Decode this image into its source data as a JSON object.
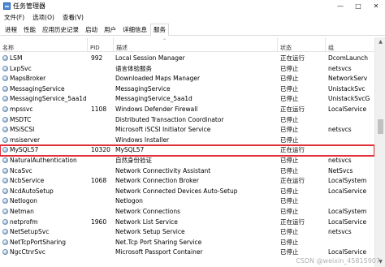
{
  "window": {
    "title": "任务管理器",
    "controls": [
      "—",
      "□",
      "✕"
    ]
  },
  "menu": [
    "文件(F)",
    "选项(O)",
    "查看(V)"
  ],
  "tabs": [
    "进程",
    "性能",
    "应用历史记录",
    "启动",
    "用户",
    "详细信息",
    "服务"
  ],
  "active_tab": "服务",
  "columns": {
    "name": "名称",
    "pid": "PID",
    "desc": "描述",
    "status": "状态",
    "group": "组"
  },
  "rows": [
    {
      "name": "LSM",
      "pid": "992",
      "desc": "Local Session Manager",
      "status": "正在运行",
      "group": "DcomLaunch"
    },
    {
      "name": "LxpSvc",
      "pid": "",
      "desc": "语言体验服务",
      "status": "已停止",
      "group": "netsvcs"
    },
    {
      "name": "MapsBroker",
      "pid": "",
      "desc": "Downloaded Maps Manager",
      "status": "已停止",
      "group": "NetworkServ"
    },
    {
      "name": "MessagingService",
      "pid": "",
      "desc": "MessagingService",
      "status": "已停止",
      "group": "UnistackSvc"
    },
    {
      "name": "MessagingService_5aa1d",
      "pid": "",
      "desc": "MessagingService_5aa1d",
      "status": "已停止",
      "group": "UnistackSvcG"
    },
    {
      "name": "mpssvc",
      "pid": "1108",
      "desc": "Windows Defender Firewall",
      "status": "正在运行",
      "group": "LocalService"
    },
    {
      "name": "MSDTC",
      "pid": "",
      "desc": "Distributed Transaction Coordinator",
      "status": "已停止",
      "group": ""
    },
    {
      "name": "MSiSCSI",
      "pid": "",
      "desc": "Microsoft iSCSI Initiator Service",
      "status": "已停止",
      "group": "netsvcs"
    },
    {
      "name": "msiserver",
      "pid": "",
      "desc": "Windows Installer",
      "status": "已停止",
      "group": ""
    },
    {
      "name": "MySQL57",
      "pid": "10320",
      "desc": "MySQL57",
      "status": "正在运行",
      "group": ""
    },
    {
      "name": "NaturalAuthentication",
      "pid": "",
      "desc": "自然身份验证",
      "status": "已停止",
      "group": "netsvcs"
    },
    {
      "name": "NcaSvc",
      "pid": "",
      "desc": "Network Connectivity Assistant",
      "status": "已停止",
      "group": "NetSvcs"
    },
    {
      "name": "NcbService",
      "pid": "1068",
      "desc": "Network Connection Broker",
      "status": "正在运行",
      "group": "LocalSystem"
    },
    {
      "name": "NcdAutoSetup",
      "pid": "",
      "desc": "Network Connected Devices Auto-Setup",
      "status": "已停止",
      "group": "LocalService"
    },
    {
      "name": "Netlogon",
      "pid": "",
      "desc": "Netlogon",
      "status": "已停止",
      "group": ""
    },
    {
      "name": "Netman",
      "pid": "",
      "desc": "Network Connections",
      "status": "已停止",
      "group": "LocalSystem"
    },
    {
      "name": "netprofm",
      "pid": "1960",
      "desc": "Network List Service",
      "status": "正在运行",
      "group": "LocalService"
    },
    {
      "name": "NetSetupSvc",
      "pid": "",
      "desc": "Network Setup Service",
      "status": "已停止",
      "group": "netsvcs"
    },
    {
      "name": "NetTcpPortSharing",
      "pid": "",
      "desc": "Net.Tcp Port Sharing Service",
      "status": "已停止",
      "group": ""
    },
    {
      "name": "NgcCtnrSvc",
      "pid": "",
      "desc": "Microsoft Passport Container",
      "status": "已停止",
      "group": "LocalService"
    }
  ],
  "highlighted_row": "MySQL57",
  "watermark": "CSDN @weixin_45815907",
  "colors": {
    "highlight_border": "#e0303a",
    "service_icon": "#9fb9d6"
  }
}
